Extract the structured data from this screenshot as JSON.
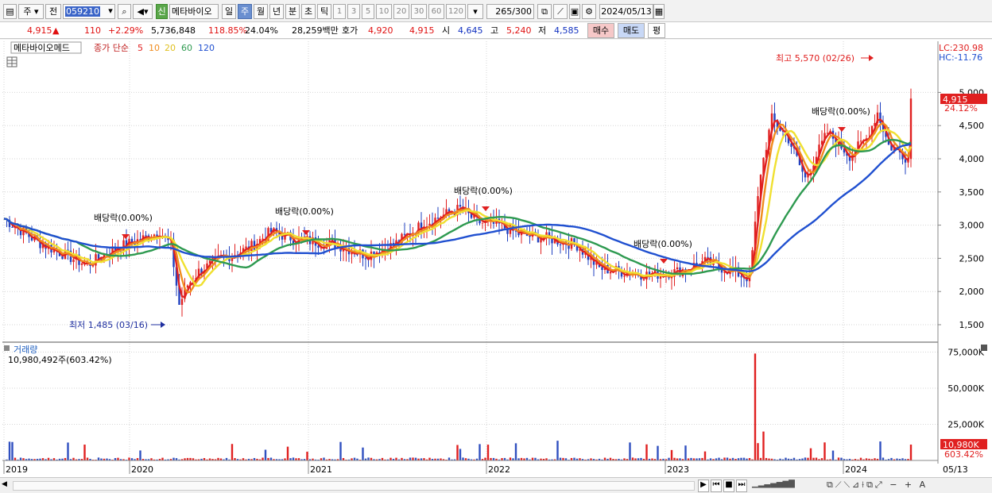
{
  "toolbar": {
    "type_select": "주",
    "prev_label": "전",
    "code_value": "059210",
    "market_badge": "신",
    "stock_name": "메타바이오",
    "period_day": "일",
    "period_week": "주",
    "period_month": "월",
    "period_year": "년",
    "period_minute": "분",
    "period_second": "초",
    "period_tick": "틱",
    "intervals": [
      "1",
      "3",
      "5",
      "10",
      "20",
      "30",
      "60",
      "120"
    ],
    "count_value": "265",
    "count_total": "/300",
    "date_value": "2024/05/13"
  },
  "quote": {
    "price": "4,915",
    "change_arrow": "▲",
    "change": "110",
    "change_pct": "+2.29%",
    "volume": "5,736,848",
    "volume_ratio": "118.85%",
    "turnover": "24.04%",
    "amount": "28,259백만",
    "hoga_label": "호가",
    "ask": "4,920",
    "bid": "4,915",
    "open_label": "시",
    "open": "4,645",
    "high_label": "고",
    "high": "5,240",
    "low_label": "저",
    "low": "4,585",
    "buy_label": "매수",
    "sell_label": "매도",
    "eval_label": "평"
  },
  "chart": {
    "name_box": "메타바이오메드",
    "ma_label": "종가 단순",
    "ma_periods": [
      "5",
      "10",
      "20",
      "60",
      "120"
    ],
    "ma_colors": [
      "#e02020",
      "#f08c1e",
      "#f0e030",
      "#2e9a50",
      "#2050d0"
    ],
    "lc": "LC:230.98",
    "hc": "HC:-11.76",
    "high_annot": "최고 5,570 (02/26)",
    "low_annot": "최저 1,485 (03/16)",
    "dividend_label": "배당락(0.00%)",
    "price_tag": "4,915",
    "price_tag_pct": "24.12%",
    "y_ticks": [
      "5,000",
      "4,500",
      "4,000",
      "3,500",
      "3,000",
      "2,500",
      "2,000",
      "1,500"
    ],
    "volume_title": "거래량",
    "volume_value": "10,980,492주(603.42%)",
    "vol_ticks": [
      "75,000K",
      "50,000K",
      "25,000K"
    ],
    "vol_tag": "10,980K",
    "vol_tag_pct": "603.42%",
    "x_ticks": [
      "2019",
      "2020",
      "2021",
      "2022",
      "2023",
      "2024"
    ],
    "x_end_label": "05/13"
  },
  "chart_data": {
    "type": "candlestick",
    "x_labels": [
      "2019",
      "2020",
      "2021",
      "2022",
      "2023",
      "2024"
    ],
    "y_range": [
      1400,
      5700
    ],
    "close_approx": [
      {
        "date": "2019-01",
        "close": 3100
      },
      {
        "date": "2019-07",
        "close": 2450
      },
      {
        "date": "2020-01",
        "close": 2800
      },
      {
        "date": "2020-03",
        "close": 1800
      },
      {
        "date": "2020-09",
        "close": 2900
      },
      {
        "date": "2021-01",
        "close": 2700
      },
      {
        "date": "2021-07",
        "close": 3200
      },
      {
        "date": "2022-01",
        "close": 2900
      },
      {
        "date": "2022-07",
        "close": 2300
      },
      {
        "date": "2023-01",
        "close": 2450
      },
      {
        "date": "2023-06",
        "close": 2250
      },
      {
        "date": "2023-09",
        "close": 4500
      },
      {
        "date": "2024-02",
        "close": 4800
      },
      {
        "date": "2024-05",
        "close": 4915
      }
    ],
    "high": {
      "value": 5570,
      "date": "02/26"
    },
    "low": {
      "value": 1485,
      "date": "03/16"
    },
    "last_volume": 10980492
  }
}
